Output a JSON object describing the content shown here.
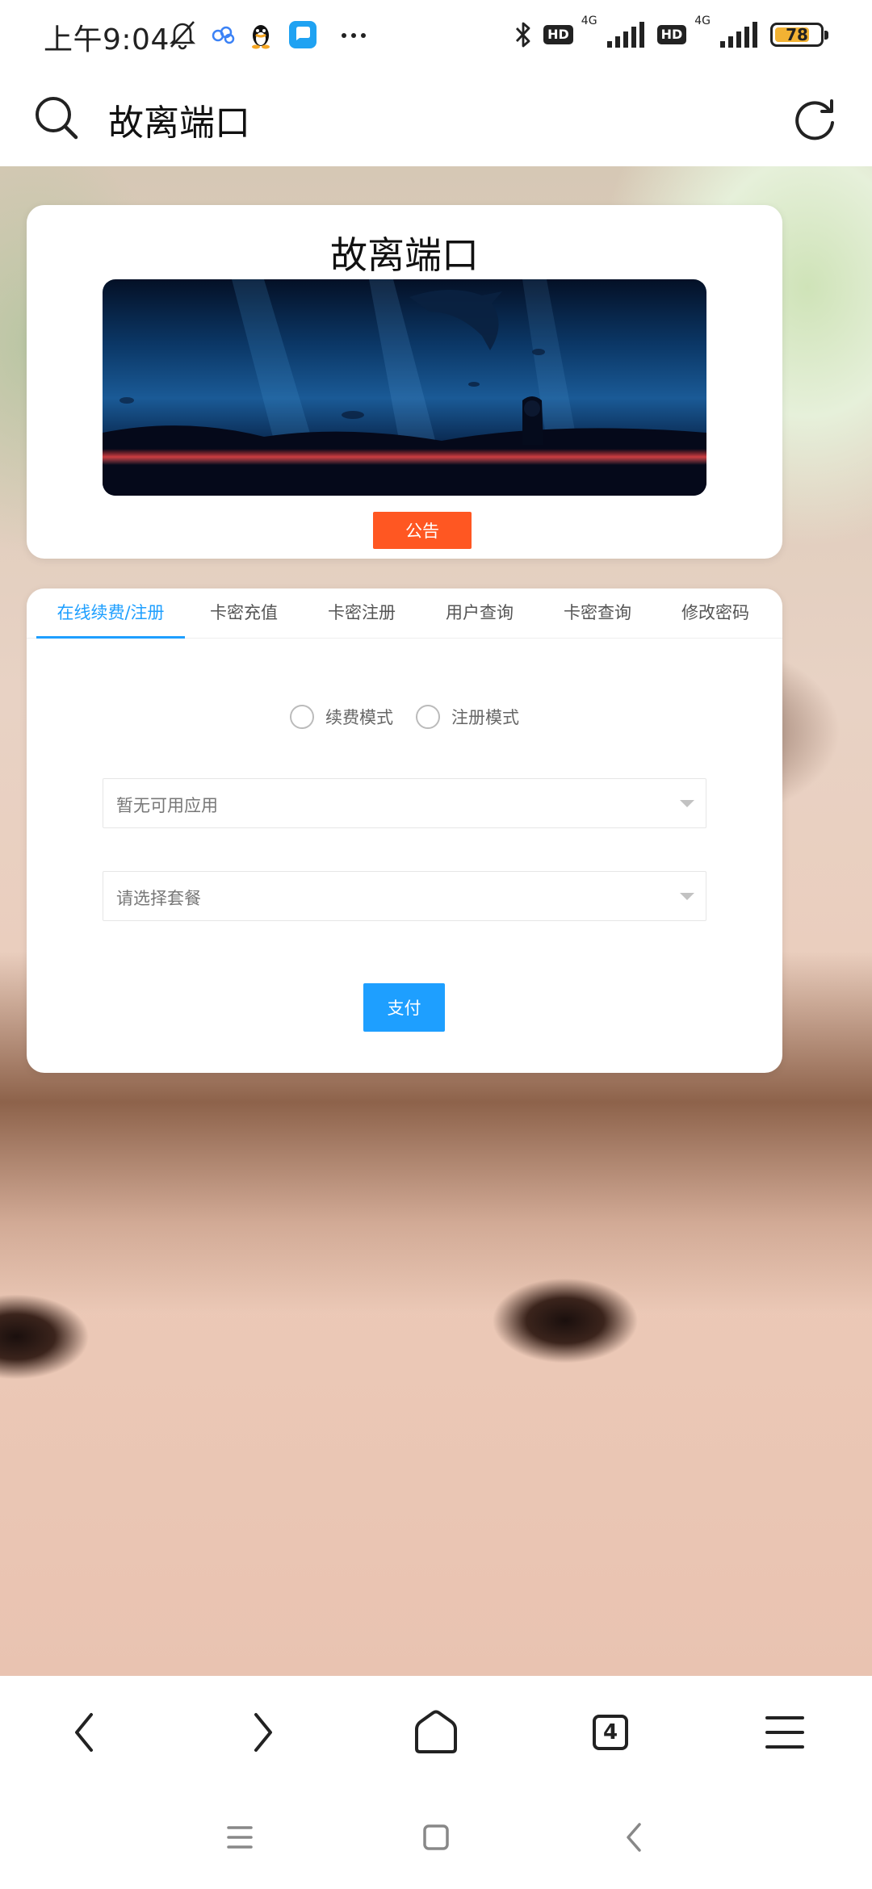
{
  "status_bar": {
    "time": "上午9:04",
    "hd_badge": "HD",
    "net_label": "4G",
    "battery": "78",
    "battery_level": 0.78
  },
  "address_bar": {
    "page_title": "故离端口"
  },
  "header_card": {
    "site_title": "故离端口",
    "notice_button": "公告"
  },
  "tabs": [
    {
      "label": "在线续费/注册",
      "active": true
    },
    {
      "label": "卡密充值",
      "active": false
    },
    {
      "label": "卡密注册",
      "active": false
    },
    {
      "label": "用户查询",
      "active": false
    },
    {
      "label": "卡密查询",
      "active": false
    },
    {
      "label": "修改密码",
      "active": false
    }
  ],
  "form": {
    "mode_options": [
      "续费模式",
      "注册模式"
    ],
    "app_select": "暂无可用应用",
    "package_select": "请选择套餐",
    "pay_button": "支付"
  },
  "browser_nav": {
    "tab_count": "4"
  },
  "colors": {
    "accent_blue": "#1e9fff",
    "notice_orange": "#ff5722",
    "battery_yellow": "#f2b233"
  }
}
